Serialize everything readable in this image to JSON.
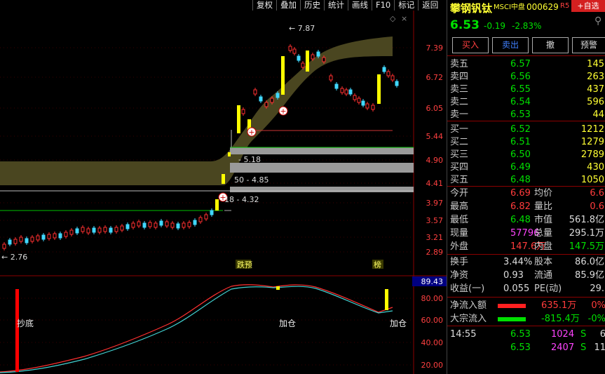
{
  "toolbar": {
    "items": [
      "复权",
      "叠加",
      "历史",
      "统计",
      "画线",
      "F10",
      "标记",
      "返回"
    ]
  },
  "chart_main": {
    "y_ticks": [
      "7.39",
      "6.72",
      "6.05",
      "5.44",
      "4.90",
      "4.41",
      "3.97",
      "3.57",
      "3.21",
      "2.89"
    ],
    "annotations": {
      "high": "7.87",
      "low": "2.76",
      "lvl_518": "5.18",
      "lvl_485": "50 - 4.85",
      "lvl_432": "18 - 4.32"
    },
    "markers": {
      "m1": "跌",
      "m1b": "预",
      "m2": "榜"
    }
  },
  "chart_sub": {
    "current": "89.43",
    "y_ticks": [
      "80.00",
      "60.00",
      "40.00",
      "20.00"
    ],
    "labels": {
      "bottom": "抄底",
      "add1": "加仓",
      "add2": "加仓"
    }
  },
  "quote": {
    "name": "攀钢钒钛",
    "tag": "MSCI中盘",
    "code": "000629",
    "tag2": "R5",
    "add_button": "+自选",
    "price": "6.53",
    "change": "-0.19",
    "change_pct": "-2.83%",
    "buttons": {
      "buy": "买入",
      "sell": "卖出",
      "cancel": "撤",
      "alert": "预警"
    },
    "asks": [
      {
        "label": "卖五",
        "price": "6.57",
        "vol": "145"
      },
      {
        "label": "卖四",
        "price": "6.56",
        "vol": "263"
      },
      {
        "label": "卖三",
        "price": "6.55",
        "vol": "437"
      },
      {
        "label": "卖二",
        "price": "6.54",
        "vol": "596"
      },
      {
        "label": "卖一",
        "price": "6.53",
        "vol": "44"
      }
    ],
    "bids": [
      {
        "label": "买一",
        "price": "6.52",
        "vol": "1212"
      },
      {
        "label": "买二",
        "price": "6.51",
        "vol": "1279"
      },
      {
        "label": "买三",
        "price": "6.50",
        "vol": "2789"
      },
      {
        "label": "买四",
        "price": "6.49",
        "vol": "430"
      },
      {
        "label": "买五",
        "price": "6.48",
        "vol": "1050"
      }
    ],
    "stats": [
      {
        "l1": "今开",
        "v1": "6.69",
        "l2": "均价",
        "v2": "6.6"
      },
      {
        "l1": "最高",
        "v1": "6.82",
        "l2": "量比",
        "v2": "0.6"
      },
      {
        "l1": "最低",
        "v1": "6.48",
        "l2": "市值",
        "v2": "561.8亿"
      },
      {
        "l1": "现量",
        "v1": "57796",
        "l2": "总量",
        "v2": "295.1万"
      },
      {
        "l1": "外盘",
        "v1": "147.6万",
        "l2": "内盘",
        "v2": "147.5万"
      }
    ],
    "stats2": [
      {
        "l1": "换手",
        "v1": "3.44%",
        "l2": "股本",
        "v2": "86.0亿"
      },
      {
        "l1": "净资",
        "v1": "0.93",
        "l2": "流通",
        "v2": "85.9亿"
      },
      {
        "l1": "收益(一)",
        "v1": "0.055",
        "l2": "PE(动)",
        "v2": "29."
      }
    ],
    "flows": [
      {
        "label": "净流入额",
        "value": "635.1万",
        "extra": "0%"
      },
      {
        "label": "大宗流入",
        "value": "-815.4万",
        "extra": "-0%"
      }
    ],
    "ticks": [
      {
        "time": "14:55",
        "price": "6.53",
        "vol": "1024",
        "side": "S",
        "n": "6"
      },
      {
        "time": "",
        "price": "6.53",
        "vol": "2407",
        "side": "S",
        "n": "11"
      }
    ],
    "colors": {
      "up": "#ff3b3b",
      "down": "#00e000",
      "yellow": "#ffff00",
      "purple": "#ff44ff"
    }
  }
}
